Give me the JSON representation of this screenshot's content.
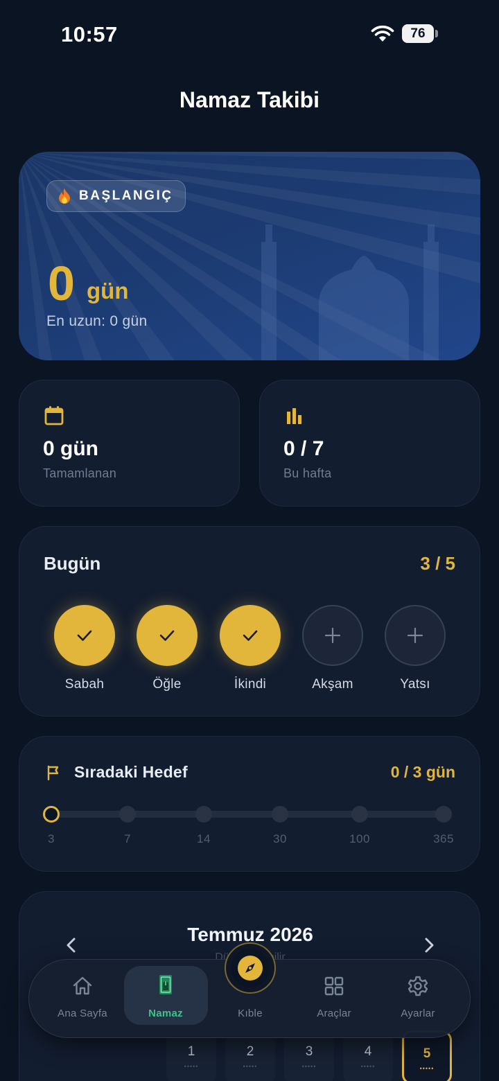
{
  "status_bar": {
    "time": "10:57",
    "battery": "76"
  },
  "page": {
    "title": "Namaz Takibi"
  },
  "hero": {
    "badge": "BAŞLANGIÇ",
    "streak_value": "0",
    "streak_unit": "gün",
    "longest": "En uzun: 0 gün"
  },
  "stats": [
    {
      "icon": "calendar-icon",
      "value": "0 gün",
      "label": "Tamamlanan"
    },
    {
      "icon": "bar-chart-icon",
      "value": "0 / 7",
      "label": "Bu hafta"
    }
  ],
  "today": {
    "title": "Bugün",
    "count": "3 / 5",
    "prayers": [
      {
        "name": "Sabah",
        "done": true
      },
      {
        "name": "Öğle",
        "done": true
      },
      {
        "name": "İkindi",
        "done": true
      },
      {
        "name": "Akşam",
        "done": false
      },
      {
        "name": "Yatsı",
        "done": false
      }
    ]
  },
  "goal": {
    "title": "Sıradaki Hedef",
    "count": "0 / 3 gün",
    "milestones": [
      "3",
      "7",
      "14",
      "30",
      "100",
      "365"
    ],
    "active_index": 0
  },
  "calendar": {
    "title": "Temmuz 2026",
    "subtitle": "Düzenlenebilir",
    "days": [
      {
        "num": "1",
        "dots": "•••••"
      },
      {
        "num": "2",
        "dots": "•••••"
      },
      {
        "num": "3",
        "dots": "•••••"
      },
      {
        "num": "4",
        "dots": "•••••"
      },
      {
        "num": "5",
        "dots": "•••••",
        "selected": true
      }
    ]
  },
  "nav": {
    "items": [
      {
        "label": "Ana Sayfa",
        "icon": "home-icon"
      },
      {
        "label": "Namaz",
        "icon": "prayer-mat-icon",
        "active": true
      },
      {
        "label": "Kıble",
        "icon": "compass-icon"
      },
      {
        "label": "Araçlar",
        "icon": "grid-icon"
      },
      {
        "label": "Ayarlar",
        "icon": "gear-icon"
      }
    ]
  },
  "colors": {
    "accent": "#e2b63b",
    "active_nav": "#3ec28a",
    "background": "#0b1422",
    "card": "#131d30"
  }
}
